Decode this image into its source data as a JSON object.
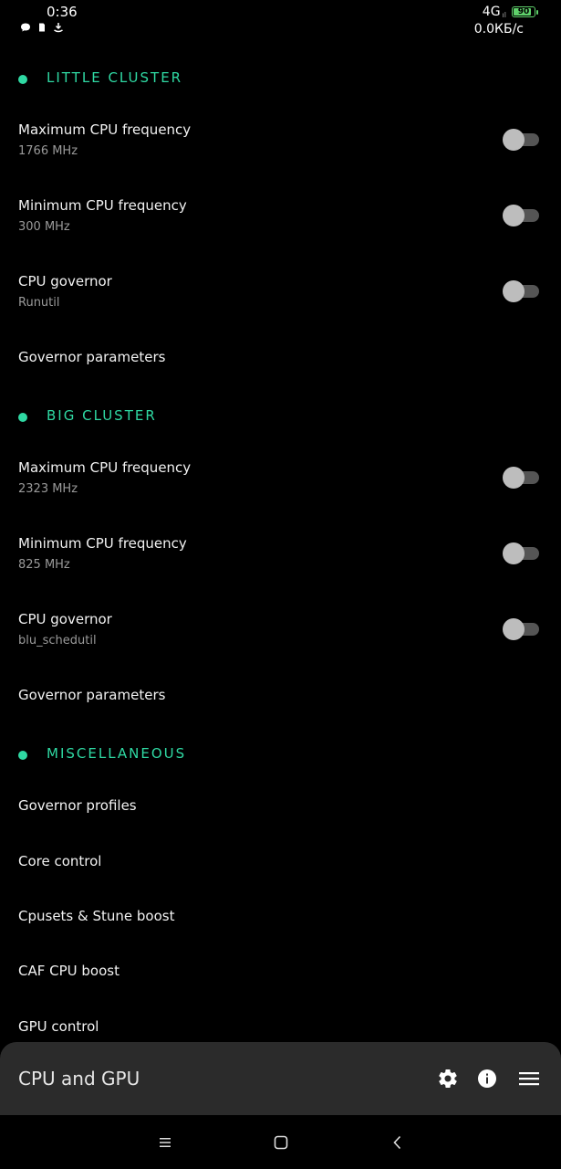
{
  "status_bar": {
    "time": "0:36",
    "network": "4G",
    "signal": "ıl",
    "battery_level": "90",
    "battery_fraction": 0.9,
    "speed": "0.0КБ/с",
    "left_icons": [
      "chat-bubble-icon",
      "sim-card-icon",
      "download-icon"
    ]
  },
  "sections": [
    {
      "title": "LITTLE CLUSTER",
      "rows": [
        {
          "title": "Maximum CPU frequency",
          "subtitle": "1766 MHz",
          "toggle": false
        },
        {
          "title": "Minimum CPU frequency",
          "subtitle": "300 MHz",
          "toggle": false
        },
        {
          "title": "CPU governor",
          "subtitle": "Runutil",
          "toggle": false
        },
        {
          "title": "Governor parameters"
        }
      ]
    },
    {
      "title": "BIG CLUSTER",
      "rows": [
        {
          "title": "Maximum CPU frequency",
          "subtitle": "2323 MHz",
          "toggle": false
        },
        {
          "title": "Minimum CPU frequency",
          "subtitle": "825 MHz",
          "toggle": false
        },
        {
          "title": "CPU governor",
          "subtitle": "blu_schedutil",
          "toggle": false
        },
        {
          "title": "Governor parameters"
        }
      ]
    },
    {
      "title": "MISCELLANEOUS",
      "rows": [
        {
          "title": "Governor profiles"
        },
        {
          "title": "Core control"
        },
        {
          "title": "Cpusets & Stune boost"
        },
        {
          "title": "CAF CPU boost"
        },
        {
          "title": "GPU control"
        }
      ]
    }
  ],
  "app_bar": {
    "title": "CPU and GPU",
    "icons": [
      "settings-icon",
      "info-icon",
      "menu-icon"
    ]
  },
  "nav_bar": {
    "buttons": [
      "recents-icon",
      "home-icon",
      "back-icon"
    ]
  },
  "colors": {
    "accent": "#2fd9a3",
    "background": "#000000",
    "app_bar": "#2b2b2b",
    "battery": "#5fd16b"
  }
}
